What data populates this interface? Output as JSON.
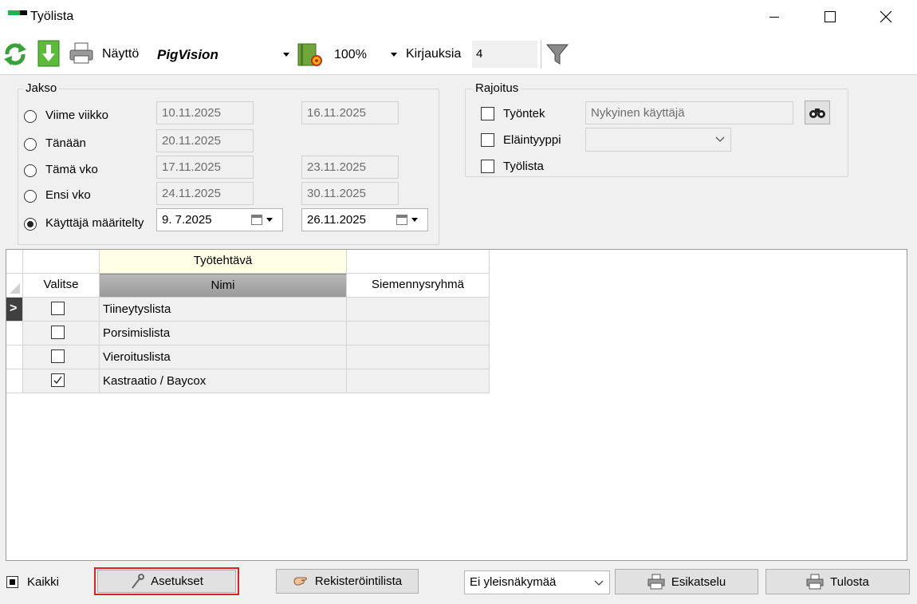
{
  "window": {
    "title": "Työlista"
  },
  "toolbar": {
    "naytto_label": "Näyttö",
    "naytto_value": "PigVision",
    "zoom_value": "100%",
    "kirjauksia_label": "Kirjauksia",
    "kirjauksia_value": "4"
  },
  "jakso": {
    "title": "Jakso",
    "rows": [
      {
        "label": "Viime viikko",
        "from": "10.11.2025",
        "to": "16.11.2025",
        "selected": false
      },
      {
        "label": "Tänään",
        "from": "20.11.2025",
        "to": "",
        "selected": false
      },
      {
        "label": "Tämä vko",
        "from": "17.11.2025",
        "to": "23.11.2025",
        "selected": false
      },
      {
        "label": "Ensi vko",
        "from": "24.11.2025",
        "to": "30.11.2025",
        "selected": false
      },
      {
        "label": "Käyttäjä määritelty",
        "from": "9.  7.2025",
        "to": "26.11.2025",
        "selected": true
      }
    ]
  },
  "rajoitus": {
    "title": "Rajoitus",
    "tyontek_label": "Työntek",
    "tyontek_value": "Nykyinen käyttäjä",
    "elaintyyppi_label": "Eläintyyppi",
    "elaintyyppi_value": "",
    "tyolista_label": "Työlista"
  },
  "grid": {
    "band_header": "Työtehtävä",
    "columns": [
      "Valitse",
      "Nimi",
      "Siemennysryhmä"
    ],
    "current_row_marker": ">",
    "rows": [
      {
        "checked": false,
        "nimi": "Tiineytyslista",
        "siemennysryhma": ""
      },
      {
        "checked": false,
        "nimi": "Porsimislista",
        "siemennysryhma": ""
      },
      {
        "checked": false,
        "nimi": "Vieroituslista",
        "siemennysryhma": ""
      },
      {
        "checked": true,
        "nimi": "Kastraatio / Baycox",
        "siemennysryhma": ""
      }
    ]
  },
  "bottom": {
    "kaikki_label": "Kaikki",
    "asetukset_label": "Asetukset",
    "rekisterointilista_label": "Rekisteröintilista",
    "view_select_value": "Ei yleisnäkymää",
    "esikatselu_label": "Esikatselu",
    "tulosta_label": "Tulosta"
  },
  "colors": {
    "highlight": "#e02020",
    "band_header_bg": "#ffffe6",
    "nimi_header_bg": "#a9a9a9",
    "marker_bg": "#404040"
  }
}
